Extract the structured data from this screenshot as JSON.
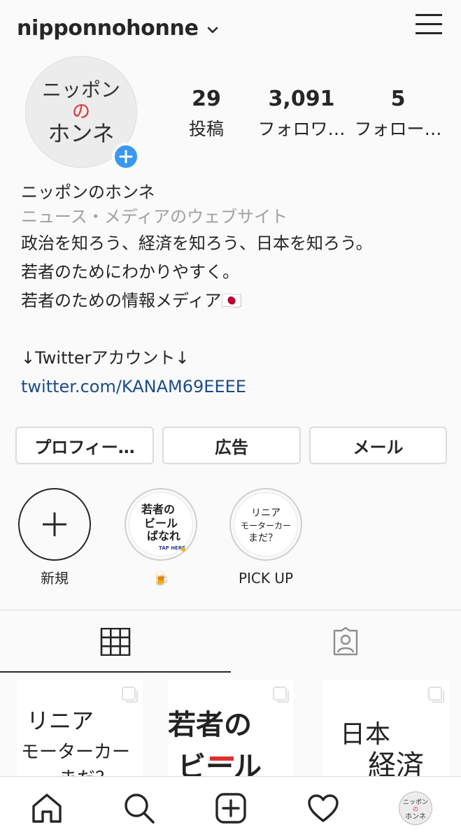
{
  "header": {
    "username": "nipponnohonne"
  },
  "profile": {
    "avatar_text_line1": "ニッポン",
    "avatar_text_line2": "の",
    "avatar_text_line3": "ホンネ",
    "stats": [
      {
        "value": "29",
        "label": "投稿"
      },
      {
        "value": "3,091",
        "label": "フォロワ…"
      },
      {
        "value": "5",
        "label": "フォロー…"
      }
    ]
  },
  "bio": {
    "name": "ニッポンのホンネ",
    "category": "ニュース・メディアのウェブサイト",
    "line1": "政治を知ろう、経済を知ろう、日本を知ろう。",
    "line2": "若者のためにわかりやすく。",
    "line3": "若者のための情報メディア🇯🇵",
    "line4": "↓Twitterアカウント↓",
    "link": "twitter.com/KANAM69EEEE"
  },
  "buttons": {
    "profile": "プロフィー…",
    "ads": "広告",
    "mail": "メール"
  },
  "highlights": [
    {
      "caption": "新規"
    },
    {
      "caption": "🍺",
      "art_line1": "若者の",
      "art_line2": "ビール",
      "art_line3": "ばなれ",
      "art_tag": "TAP HERE"
    },
    {
      "caption": "PICK UP",
      "art_line1": "リニア",
      "art_line2": "モーターカー",
      "art_line3": "まだ？"
    }
  ],
  "posts": [
    {
      "line1": "リニア",
      "line2": "モーターカー",
      "line3": "まだ？"
    },
    {
      "line1": "若者の",
      "line2": "ビール"
    },
    {
      "line1": "日本",
      "line2": "経済"
    }
  ],
  "colors": {
    "accent": "#3897f0",
    "link": "#1b4c8a",
    "secondary_text": "#a0a0a0",
    "red_mark": "#e03030"
  },
  "icons": {
    "menu": "hamburger-icon",
    "grid": "grid-icon",
    "tagged": "tagged-person-icon",
    "home": "home-icon",
    "search": "search-icon",
    "add": "add-post-icon",
    "activity": "heart-icon"
  }
}
